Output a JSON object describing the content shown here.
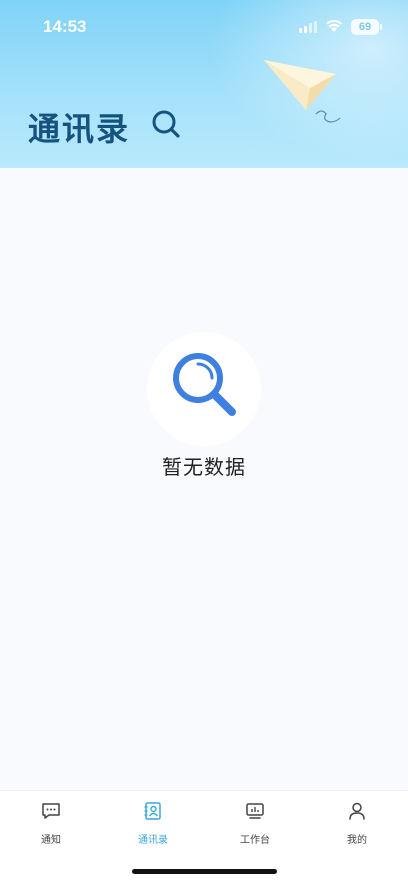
{
  "status_bar": {
    "time": "14:53",
    "battery": "69"
  },
  "header": {
    "title": "通讯录"
  },
  "empty_state": {
    "message": "暂无数据"
  },
  "tabbar": {
    "tabs": [
      {
        "label": "通知",
        "icon": "message-icon",
        "active": false
      },
      {
        "label": "通讯录",
        "icon": "contacts-icon",
        "active": true
      },
      {
        "label": "工作台",
        "icon": "workbench-icon",
        "active": false
      },
      {
        "label": "我的",
        "icon": "profile-icon",
        "active": false
      }
    ]
  },
  "colors": {
    "accent": "#3aa7e0",
    "title": "#15527e",
    "header_bg": "#8dd8f8",
    "search_blue": "#3f7fe0"
  }
}
